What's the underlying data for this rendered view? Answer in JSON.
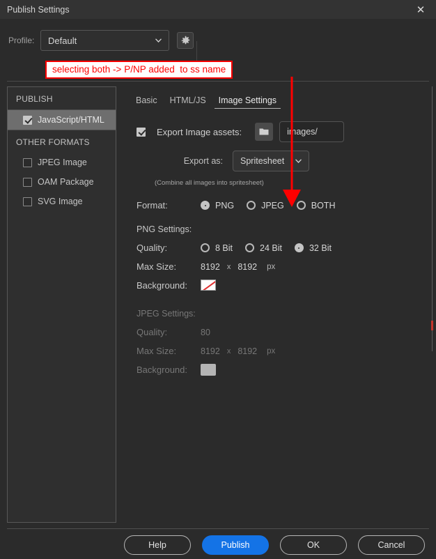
{
  "window": {
    "title": "Publish Settings",
    "close_icon": "close-icon"
  },
  "profile": {
    "label": "Profile:",
    "value": "Default",
    "chevron_icon": "chevron-down-icon",
    "gear_icon": "gear-icon"
  },
  "sidebar": {
    "sections": [
      {
        "heading": "PUBLISH",
        "items": [
          {
            "label": "JavaScript/HTML",
            "checked": true,
            "selected": true
          }
        ]
      },
      {
        "heading": "OTHER FORMATS",
        "items": [
          {
            "label": "JPEG Image",
            "checked": false,
            "selected": false
          },
          {
            "label": "OAM Package",
            "checked": false,
            "selected": false
          },
          {
            "label": "SVG Image",
            "checked": false,
            "selected": false
          }
        ]
      }
    ]
  },
  "tabs": [
    {
      "label": "Basic",
      "active": false
    },
    {
      "label": "HTML/JS",
      "active": false
    },
    {
      "label": "Image Settings",
      "active": true
    }
  ],
  "image_settings": {
    "export_assets": {
      "label": "Export Image assets:",
      "checked": true,
      "folder_icon": "folder-icon",
      "path_value": "images/"
    },
    "export_as": {
      "label": "Export as:",
      "value": "Spritesheet",
      "chevron_icon": "chevron-down-icon"
    },
    "hint": "(Combine all images into spritesheet)",
    "format": {
      "label": "Format:",
      "options": [
        {
          "label": "PNG",
          "selected": true
        },
        {
          "label": "JPEG",
          "selected": false
        },
        {
          "label": "BOTH",
          "selected": false
        }
      ]
    },
    "png_settings": {
      "title": "PNG Settings:",
      "quality_label": "Quality:",
      "quality_options": [
        {
          "label": "8 Bit",
          "selected": false
        },
        {
          "label": "24 Bit",
          "selected": false
        },
        {
          "label": "32 Bit",
          "selected": true
        }
      ],
      "maxsize_label": "Max Size:",
      "max_width": "8192",
      "separator": "x",
      "max_height": "8192",
      "unit": "px",
      "background_label": "Background:",
      "background_swatch": "transparent-swatch"
    },
    "jpeg_settings": {
      "title": "JPEG Settings:",
      "quality_label": "Quality:",
      "quality_value": "80",
      "maxsize_label": "Max Size:",
      "max_width": "8192",
      "separator": "x",
      "max_height": "8192",
      "unit": "px",
      "background_label": "Background:",
      "background_swatch": "grey-swatch",
      "disabled": true
    }
  },
  "buttons": {
    "help": "Help",
    "publish": "Publish",
    "ok": "OK",
    "cancel": "Cancel"
  },
  "annotation": {
    "text": "selecting both -> P/NP added  to ss name",
    "color": "#ff0000"
  },
  "colors": {
    "window_bg": "#2b2b2b",
    "titlebar_bg": "#333333",
    "panel_bg": "#2f2f2f",
    "selected_row": "#6e6e6e",
    "primary_button": "#1473e6",
    "annotation_red": "#ff0000"
  }
}
